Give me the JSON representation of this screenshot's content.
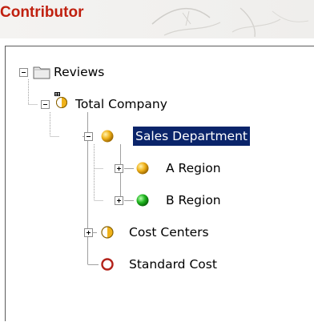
{
  "header": {
    "title": "Contributor",
    "title_color": "#c0200f"
  },
  "tree": {
    "nodes": [
      {
        "label": "Reviews",
        "icon": "folder-icon",
        "expanded": true,
        "selected": false
      },
      {
        "label": "Total Company",
        "icon": "status-half-locked-icon",
        "expanded": true,
        "selected": false
      },
      {
        "label": "Sales Department",
        "icon": "status-yellow-icon",
        "expanded": true,
        "selected": true
      },
      {
        "label": "A Region",
        "icon": "status-yellow-icon",
        "expanded": false,
        "selected": false
      },
      {
        "label": "B Region",
        "icon": "status-green-icon",
        "expanded": false,
        "selected": false
      },
      {
        "label": "Cost Centers",
        "icon": "status-half-icon",
        "expanded": false,
        "selected": false
      },
      {
        "label": "Standard Cost",
        "icon": "status-empty-icon",
        "expanded": null,
        "selected": false
      }
    ]
  },
  "colors": {
    "selection": "#0a246a",
    "status_yellow": "#f0b21a",
    "status_green": "#1fb51f",
    "status_empty": "#b3221a"
  }
}
